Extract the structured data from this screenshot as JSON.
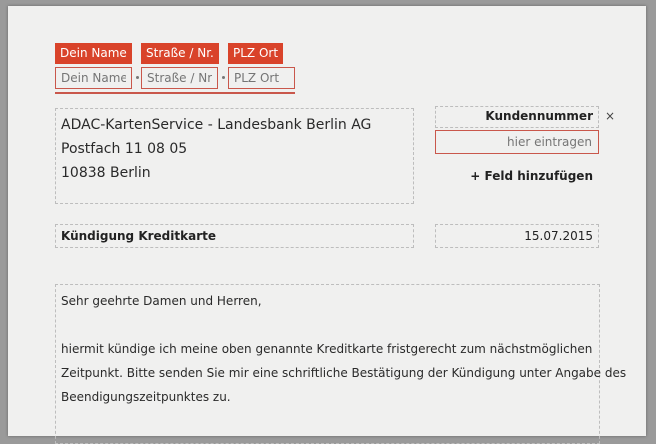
{
  "sender": {
    "name_tag": "Dein Name",
    "street_tag": "Straße / Nr.",
    "city_tag": "PLZ Ort",
    "name_placeholder": "Dein Name",
    "street_placeholder": "Straße / Nr.",
    "city_placeholder": "PLZ Ort"
  },
  "recipient": {
    "lines": [
      "ADAC-KartenService - Landesbank Berlin AG",
      "Postfach 11 08 05",
      "10838 Berlin"
    ]
  },
  "customer_number": {
    "label": "Kundennummer",
    "remove_symbol": "×",
    "placeholder": "hier eintragen",
    "add_field_label": "+ Feld hinzufügen"
  },
  "subject": "Kündigung Kreditkarte",
  "date": "15.07.2015",
  "body": {
    "salutation": "Sehr geehrte Damen und Herren,",
    "lines": [
      "hiermit kündige ich meine oben genannte Kreditkarte fristgerecht zum nächstmöglichen",
      "Zeitpunkt. Bitte senden Sie mir eine schriftliche Bestätigung der Kündigung unter Angabe des",
      "Beendigungszeitpunktes zu."
    ]
  },
  "colors": {
    "accent": "#d9432a",
    "field_border": "#c9574b",
    "paper": "#f0f0ef",
    "background": "#9a9a9a"
  }
}
